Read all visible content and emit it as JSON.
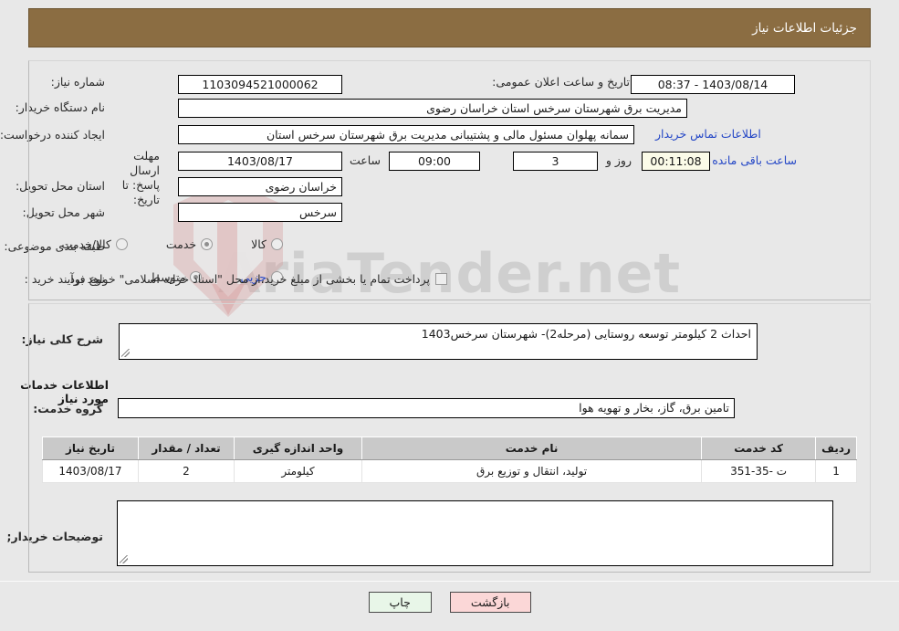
{
  "header": {
    "title": "جزئیات اطلاعات نیاز"
  },
  "top": {
    "need_number_label": "شماره نیاز:",
    "need_number_value": "1103094521000062",
    "announce_label": "تاریخ و ساعت اعلان عمومی:",
    "announce_value": "1403/08/14 - 08:37",
    "buyer_org_label": "نام دستگاه خریدار:",
    "buyer_org_value": "مدیریت برق شهرستان سرخس استان خراسان رضوی",
    "requester_label": "ایجاد کننده درخواست:",
    "requester_value": "سمانه پهلوان مسئول مالی و پشتیبانی مدیریت برق شهرستان سرخس استان",
    "contact_link": "اطلاعات تماس خریدار",
    "deadline_label_l1": "مهلت ارسال پاسخ: تا",
    "deadline_label_l2": "تاریخ:",
    "deadline_date": "1403/08/17",
    "deadline_time_label": "ساعت",
    "deadline_time": "09:00",
    "days_value": "3",
    "days_label": "روز و",
    "countdown": "00:11:08",
    "remaining_label": "ساعت باقی مانده",
    "province_label": "استان محل تحویل:",
    "province_value": "خراسان رضوی",
    "city_label": "شهر محل تحویل:",
    "city_value": "سرخس",
    "category_label": "طبقه بندی موضوعی:",
    "category_options": [
      {
        "label": "کالا",
        "selected": false
      },
      {
        "label": "خدمت",
        "selected": true
      },
      {
        "label": "کالا/خدمت",
        "selected": false
      }
    ],
    "process_label": "نوع فرآیند خرید :",
    "process_options": [
      {
        "label": "جزیی",
        "selected": false
      },
      {
        "label": "متوسط",
        "selected": true
      }
    ],
    "treasury_checkbox_label": "پرداخت تمام یا بخشی از مبلغ خرید،از محل \"اسناد خزانه اسلامی\" خواهد بود.",
    "treasury_checked": false
  },
  "mid": {
    "need_desc_label": "شرح کلی نیاز:",
    "need_desc_value": "احداث 2 کیلومتر توسعه روستایی (مرحله2)- شهرستان سرخس1403",
    "services_heading": "اطلاعات خدمات مورد نیاز",
    "service_group_label": "گروه خدمت:",
    "service_group_value": "تامین برق، گاز، بخار و تهویه هوا",
    "buyer_notes_label": "توضیحات خریدار;",
    "buyer_notes_value": ""
  },
  "table": {
    "columns": [
      "ردیف",
      "کد خدمت",
      "نام خدمت",
      "واحد اندازه گیری",
      "تعداد / مقدار",
      "تاریخ نیاز"
    ],
    "rows": [
      {
        "radif": "1",
        "code": "ت -35-351",
        "name": "تولید، انتقال و توزیع برق",
        "unit": "کیلومتر",
        "qty": "2",
        "date": "1403/08/17"
      }
    ]
  },
  "buttons": {
    "print": "چاپ",
    "back": "بازگشت"
  },
  "watermark": {
    "text": "AriaTender.net"
  },
  "colors": {
    "header_bar": "#8b6d42",
    "page_bg": "#e8e8e8",
    "link": "#2346c6",
    "print_btn": "#e8f6e8",
    "back_btn": "#fbd7d7"
  }
}
